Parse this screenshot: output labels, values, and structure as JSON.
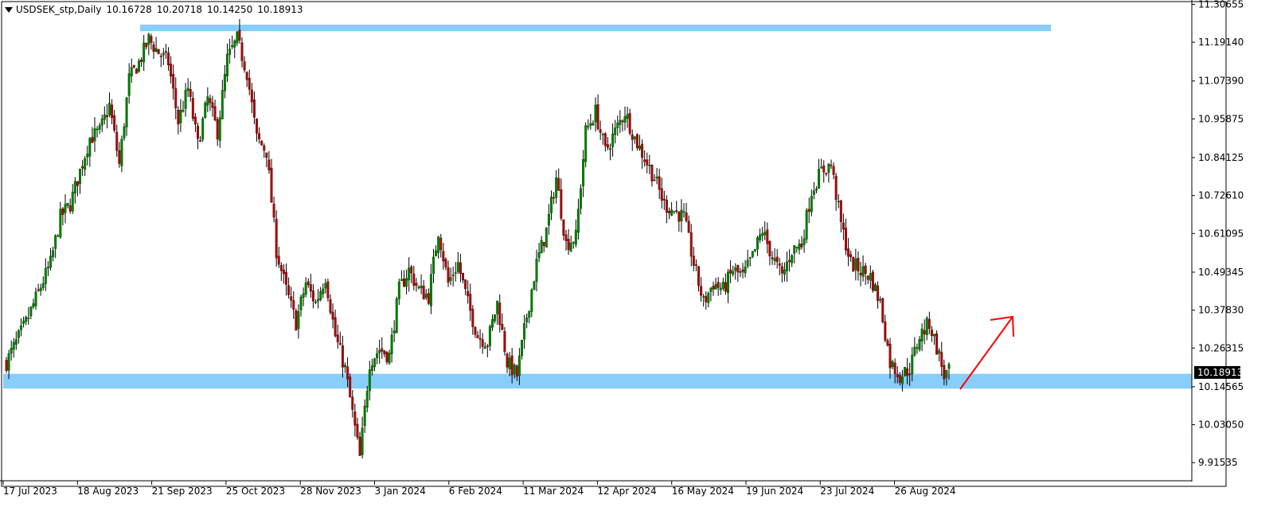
{
  "header": {
    "symbol": "USDSEK_stp,Daily",
    "open": "10.16728",
    "high": "10.20718",
    "low": "10.14250",
    "close": "10.18913"
  },
  "chart_data": {
    "type": "candlestick",
    "symbol": "USDSEK_stp",
    "timeframe": "Daily",
    "ylim": [
      9.87,
      11.31
    ],
    "y_ticks": [
      "11.30655",
      "11.19140",
      "11.07390",
      "10.95875",
      "10.84125",
      "10.72610",
      "10.61095",
      "10.49345",
      "10.37830",
      "10.26315",
      "10.14565",
      "10.03050",
      "9.91535"
    ],
    "x_ticks": [
      "17 Jul 2023",
      "18 Aug 2023",
      "21 Sep 2023",
      "25 Oct 2023",
      "28 Nov 2023",
      "3 Jan 2024",
      "6 Feb 2024",
      "11 Mar 2024",
      "12 Apr 2024",
      "16 May 2024",
      "19 Jun 2024",
      "23 Jul 2024",
      "26 Aug 2024"
    ],
    "current_price": "10.18913",
    "zones": [
      {
        "name": "resistance",
        "from": 11.225,
        "to": 11.245,
        "color": "#87cefa"
      },
      {
        "name": "support",
        "from": 10.14,
        "to": 10.185,
        "color": "#87cefa"
      }
    ],
    "close_path": [
      [
        0,
        10.22
      ],
      [
        8,
        10.34
      ],
      [
        14,
        10.45
      ],
      [
        18,
        10.52
      ],
      [
        22,
        10.66
      ],
      [
        26,
        10.7
      ],
      [
        30,
        10.8
      ],
      [
        34,
        10.9
      ],
      [
        38,
        10.92
      ],
      [
        42,
        11.0
      ],
      [
        46,
        10.82
      ],
      [
        50,
        11.08
      ],
      [
        54,
        11.13
      ],
      [
        58,
        11.2
      ],
      [
        62,
        11.16
      ],
      [
        66,
        11.13
      ],
      [
        70,
        10.95
      ],
      [
        74,
        11.05
      ],
      [
        78,
        10.88
      ],
      [
        82,
        11.02
      ],
      [
        86,
        10.92
      ],
      [
        90,
        11.14
      ],
      [
        94,
        11.2
      ],
      [
        98,
        11.1
      ],
      [
        102,
        10.9
      ],
      [
        106,
        10.86
      ],
      [
        110,
        10.56
      ],
      [
        114,
        10.44
      ],
      [
        118,
        10.34
      ],
      [
        122,
        10.46
      ],
      [
        126,
        10.4
      ],
      [
        130,
        10.48
      ],
      [
        134,
        10.3
      ],
      [
        138,
        10.2
      ],
      [
        142,
        10.02
      ],
      [
        144,
        9.93
      ],
      [
        148,
        10.22
      ],
      [
        152,
        10.26
      ],
      [
        156,
        10.24
      ],
      [
        160,
        10.44
      ],
      [
        164,
        10.5
      ],
      [
        168,
        10.44
      ],
      [
        172,
        10.42
      ],
      [
        176,
        10.62
      ],
      [
        180,
        10.46
      ],
      [
        184,
        10.52
      ],
      [
        188,
        10.4
      ],
      [
        192,
        10.3
      ],
      [
        196,
        10.28
      ],
      [
        200,
        10.4
      ],
      [
        204,
        10.22
      ],
      [
        208,
        10.18
      ],
      [
        212,
        10.36
      ],
      [
        216,
        10.52
      ],
      [
        220,
        10.62
      ],
      [
        224,
        10.78
      ],
      [
        228,
        10.58
      ],
      [
        232,
        10.6
      ],
      [
        236,
        10.92
      ],
      [
        240,
        10.98
      ],
      [
        244,
        10.86
      ],
      [
        248,
        10.92
      ],
      [
        252,
        10.98
      ],
      [
        256,
        10.9
      ],
      [
        260,
        10.84
      ],
      [
        264,
        10.78
      ],
      [
        268,
        10.7
      ],
      [
        272,
        10.68
      ],
      [
        276,
        10.66
      ],
      [
        280,
        10.52
      ],
      [
        284,
        10.4
      ],
      [
        288,
        10.46
      ],
      [
        292,
        10.44
      ],
      [
        296,
        10.5
      ],
      [
        300,
        10.48
      ],
      [
        304,
        10.54
      ],
      [
        308,
        10.62
      ],
      [
        312,
        10.54
      ],
      [
        316,
        10.48
      ],
      [
        320,
        10.56
      ],
      [
        324,
        10.58
      ],
      [
        328,
        10.74
      ],
      [
        332,
        10.8
      ],
      [
        336,
        10.82
      ],
      [
        340,
        10.64
      ],
      [
        344,
        10.52
      ],
      [
        348,
        10.5
      ],
      [
        352,
        10.48
      ],
      [
        356,
        10.4
      ],
      [
        360,
        10.22
      ],
      [
        364,
        10.18
      ],
      [
        368,
        10.2
      ],
      [
        372,
        10.3
      ],
      [
        376,
        10.34
      ],
      [
        380,
        10.24
      ],
      [
        382,
        10.18
      ],
      [
        384,
        10.19
      ]
    ],
    "candle_count": 385,
    "annotation": {
      "type": "arrow",
      "direction": "up",
      "color": "#ff0000"
    }
  },
  "colors": {
    "bull": "#006400",
    "bull_body": "#008000",
    "bear": "#8b0000",
    "bear_body": "#9b1111",
    "wick": "#000000",
    "zone": "#87cefa",
    "price_label_bg": "#000000",
    "price_label_fg": "#ffffff",
    "arrow": "#ff0000"
  }
}
